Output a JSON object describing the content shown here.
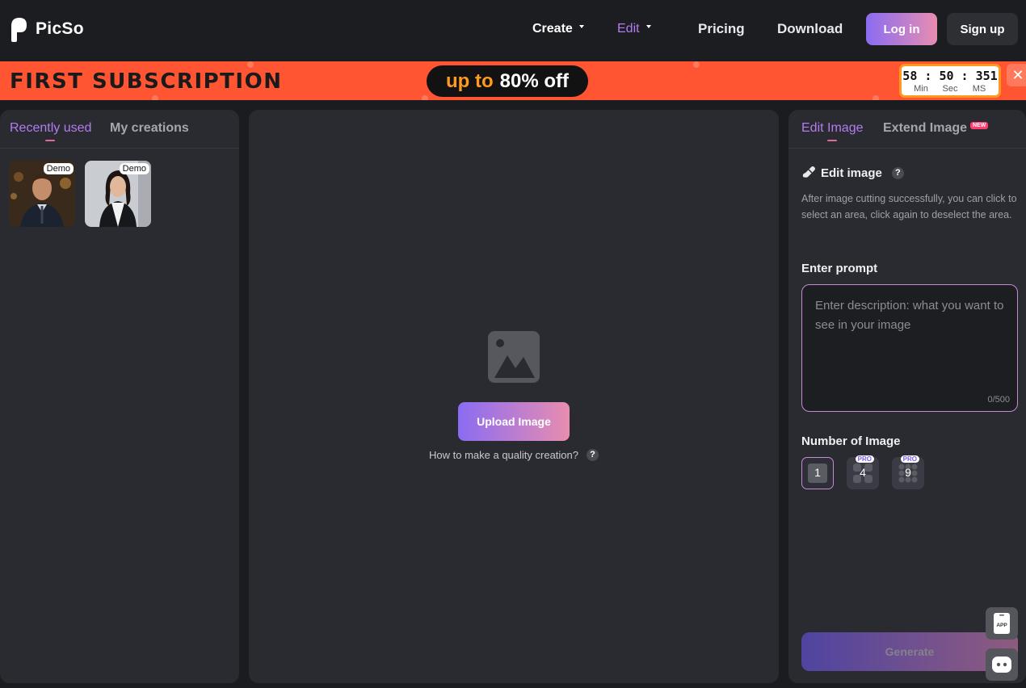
{
  "header": {
    "logo_text": "PicSo",
    "nav": {
      "create": "Create",
      "edit": "Edit",
      "pricing": "Pricing",
      "download": "Download"
    },
    "login": "Log in",
    "signup": "Sign up"
  },
  "promo": {
    "title": "FIRST SUBSCRIPTION",
    "up_to": "up to",
    "discount": "80% off",
    "timer": {
      "min": "58",
      "sec": "50",
      "ms": "351",
      "min_label": "Min",
      "sec_label": "Sec",
      "ms_label": "MS"
    },
    "close": "✕"
  },
  "left": {
    "tabs": [
      "Recently used",
      "My creations"
    ],
    "active_tab": 0,
    "thumbs": [
      {
        "badge": "Demo"
      },
      {
        "badge": "Demo"
      }
    ]
  },
  "center": {
    "upload_button": "Upload Image",
    "help_text": "How to make a quality creation?",
    "help_icon": "?"
  },
  "right": {
    "tabs": [
      "Edit Image",
      "Extend Image"
    ],
    "new_badge": "NEW",
    "active_tab": 0,
    "section_title": "Edit image",
    "section_help": "?",
    "description": "After image cutting successfully, you can click to select an area, click again to deselect the area.",
    "prompt_label": "Enter prompt",
    "prompt_placeholder": "Enter description: what you want to see in your image",
    "prompt_value": "",
    "prompt_counter": "0/500",
    "count_label": "Number of Image",
    "count_options": [
      {
        "value": "1",
        "selected": true
      },
      {
        "value": "4",
        "pro": "PRO"
      },
      {
        "value": "9",
        "pro": "PRO"
      }
    ],
    "generate": "Generate"
  },
  "floating": {
    "app_label": "APP"
  },
  "colors": {
    "accent_purple": "#b37cf0",
    "accent_pink": "#e88db0",
    "promo_bg": "#ff5533",
    "promo_orange": "#ff9a1f"
  }
}
